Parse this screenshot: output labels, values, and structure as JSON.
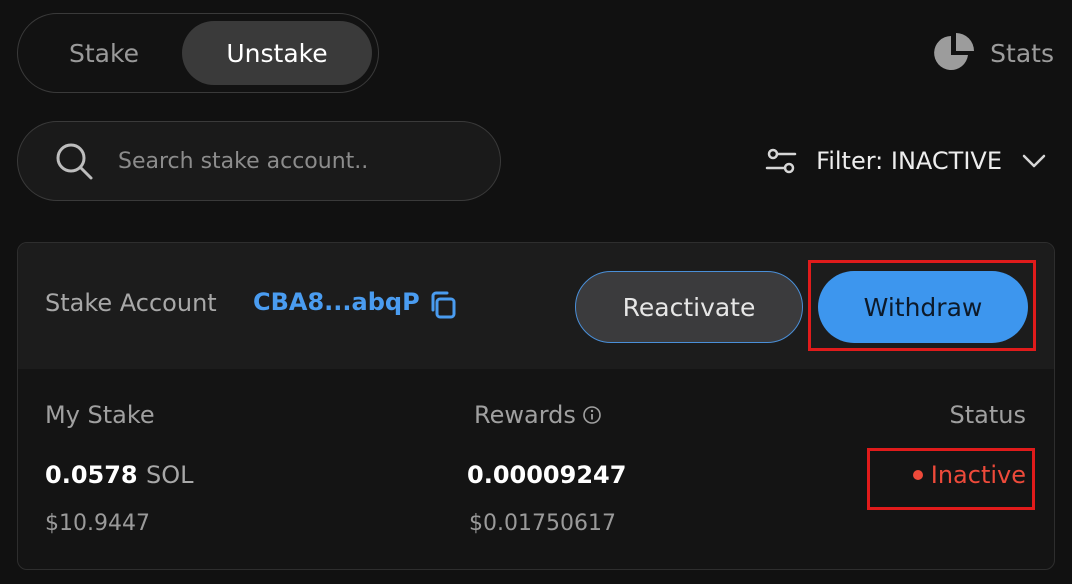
{
  "tabs": {
    "stake_label": "Stake",
    "unstake_label": "Unstake",
    "active": "Unstake"
  },
  "stats": {
    "label": "Stats",
    "icon": "pie-chart-icon"
  },
  "search": {
    "placeholder": "Search stake account.."
  },
  "filter": {
    "label": "Filter: INACTIVE",
    "icon": "sliders-icon"
  },
  "account": {
    "label": "Stake Account",
    "id": "CBA8...abqP",
    "reactivate_label": "Reactivate",
    "withdraw_label": "Withdraw",
    "my_stake_label": "My Stake",
    "my_stake_value": "0.0578",
    "my_stake_unit": "SOL",
    "my_stake_usd": "$10.9447",
    "rewards_label": "Rewards",
    "rewards_value": "0.00009247",
    "rewards_usd": "$0.01750617",
    "status_label": "Status",
    "status_value": "Inactive"
  },
  "colors": {
    "accent": "#3d96ee",
    "status_inactive": "#ee4a3a",
    "highlight": "#e01b1b"
  }
}
